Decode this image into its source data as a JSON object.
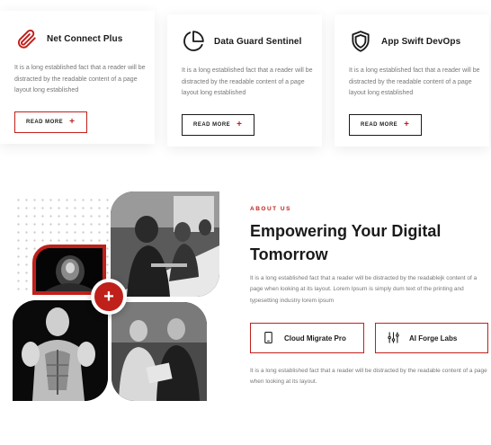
{
  "cards": [
    {
      "title": "Net Connect Plus",
      "icon": "paperclip-icon",
      "text": "It is a long established fact that a reader will be distracted by the readable content of a page layout long established",
      "button": "READ MORE"
    },
    {
      "title": "Data Guard Sentinel",
      "icon": "pie-chart-icon",
      "text": "It is a long established fact that a reader will be distracted by the readable content of a page layout long established",
      "button": "READ MORE"
    },
    {
      "title": "App Swift DevOps",
      "icon": "shield-icon",
      "text": "It is a long established fact that a reader will be distracted by the readable content of a page layout long established",
      "button": "READ MORE"
    }
  ],
  "about": {
    "label": "ABOUT US",
    "heading": "Empowering Your Digital Tomorrow",
    "text": "It is a long established fact that a reader will be distracted by the readablejk content of a page when looking at its layout. Lorem Ipsum is simply dum text of the printing and typesetting industry lorem ipsum",
    "features": [
      {
        "label": "Cloud Migrate Pro",
        "icon": "mobile-icon"
      },
      {
        "label": "AI Forge Labs",
        "icon": "sliders-icon"
      }
    ],
    "text2": "It is a long established fact that a reader will be distracted by the readable content of a page when looking at its layout.",
    "plus_symbol": "+"
  },
  "colors": {
    "accent": "#c0201a",
    "dark": "#1a1a1a",
    "muted_text": "#777777"
  }
}
